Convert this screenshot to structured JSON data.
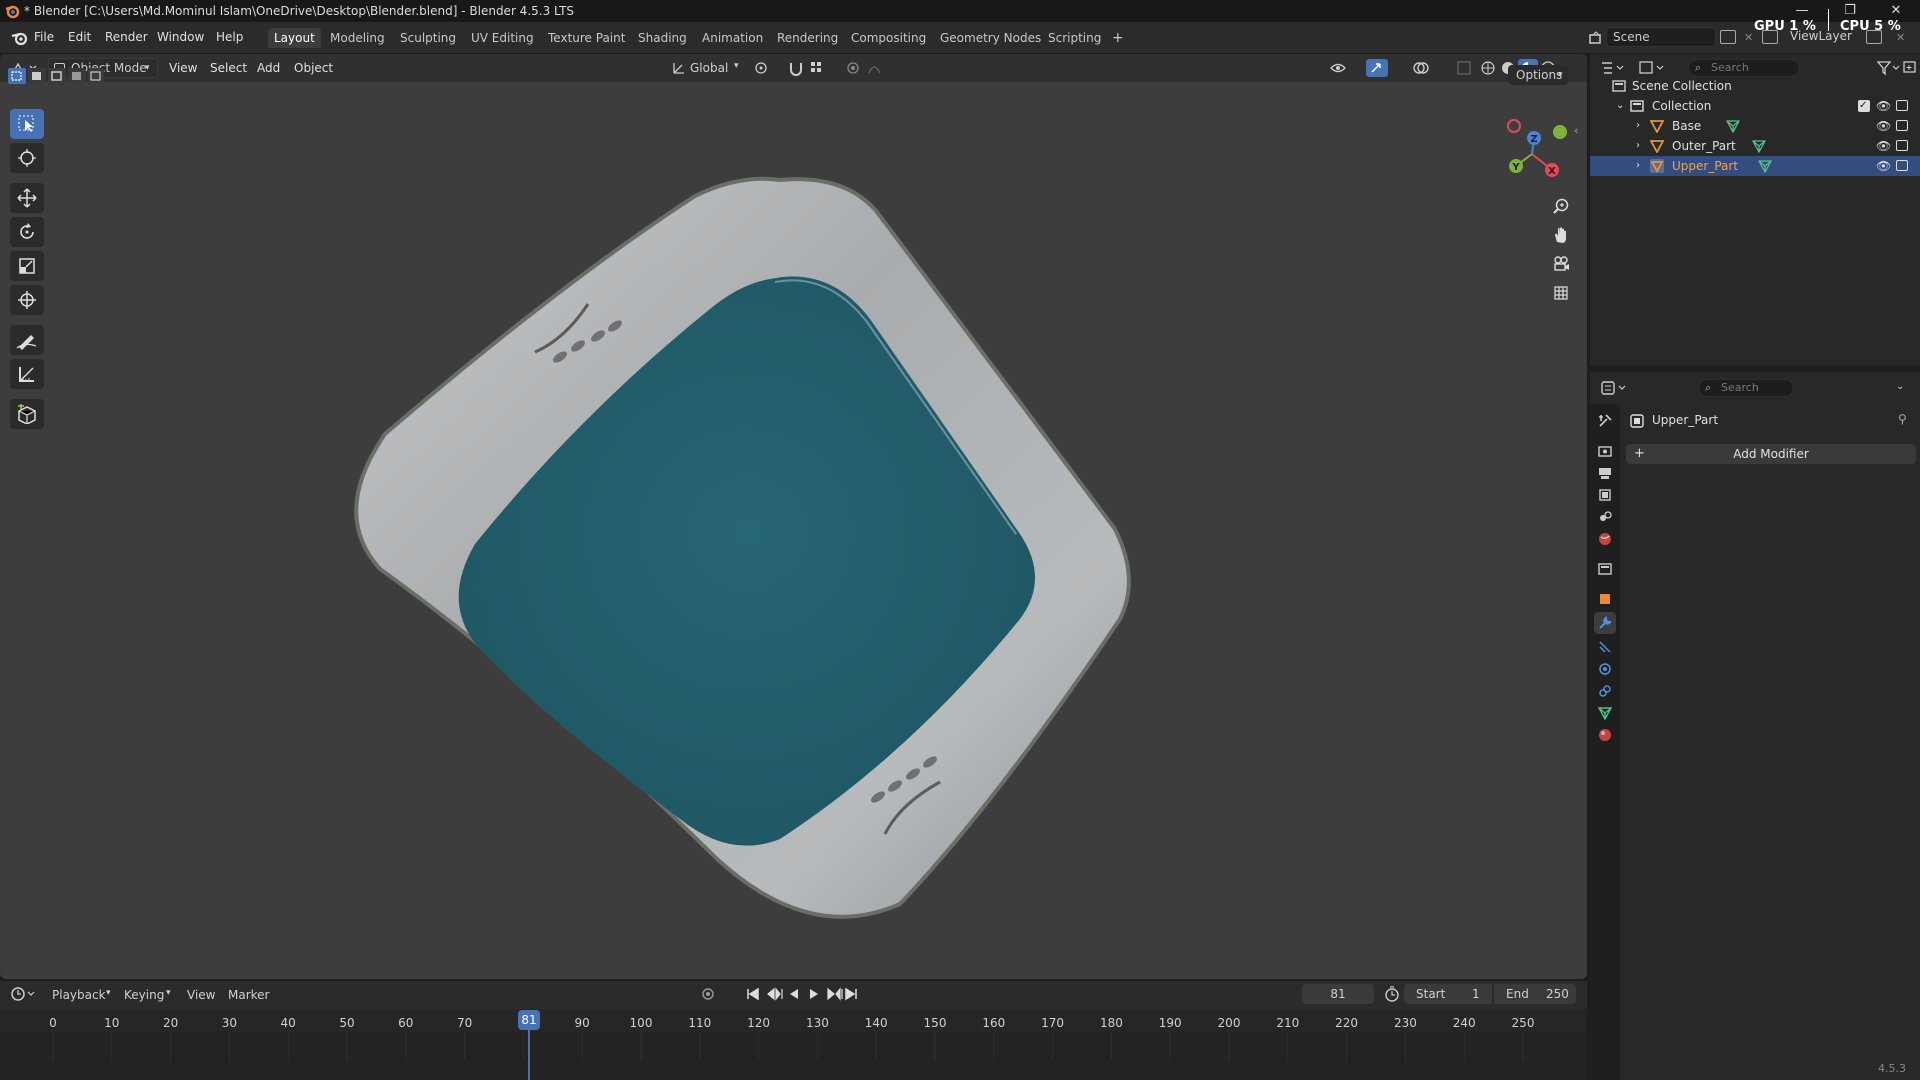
{
  "window": {
    "title": "* Blender [C:\\Users\\Md.Mominul Islam\\OneDrive\\Desktop\\Blender.blend] - Blender 4.5.3 LTS",
    "controls": [
      "—",
      "❐",
      "✕"
    ]
  },
  "menu": {
    "items": [
      "File",
      "Edit",
      "Render",
      "Window",
      "Help"
    ]
  },
  "workspaces": [
    "Layout",
    "Modeling",
    "Sculpting",
    "UV Editing",
    "Texture Paint",
    "Shading",
    "Animation",
    "Rendering",
    "Compositing",
    "Geometry Nodes",
    "Scripting"
  ],
  "workspace_active": "Layout",
  "add_workspace": "+",
  "scene_field": "Scene",
  "viewlayer_field": "ViewLayer",
  "stats": {
    "gpu_label": "GPU",
    "gpu_value": "1 %",
    "cpu_label": "CPU",
    "cpu_value": "5 %"
  },
  "viewport_header": {
    "mode": "Object Mode",
    "menus": [
      "View",
      "Select",
      "Add",
      "Object"
    ],
    "orientation": "Global",
    "options": "Options"
  },
  "toolbar_tools": [
    "select-box",
    "cursor",
    "move",
    "rotate",
    "scale",
    "transform",
    "annotate",
    "measure",
    "add-cube"
  ],
  "model": {
    "rim_color": "#a8abae",
    "inner_color": "#245f6a"
  },
  "gizmo": {
    "x": "X",
    "y": "Y",
    "z": "Z",
    "x_color": "#e04a5a",
    "y_color": "#7fb23a",
    "z_color": "#4a83d6"
  },
  "timeline": {
    "menus": [
      "Playback",
      "Keying",
      "View",
      "Marker"
    ],
    "current_frame": "81",
    "start_label": "Start",
    "start": "1",
    "end_label": "End",
    "end": "250",
    "ticks": [
      "0",
      "10",
      "20",
      "30",
      "40",
      "50",
      "60",
      "70",
      "90",
      "100",
      "110",
      "120",
      "130",
      "140",
      "150",
      "160",
      "170",
      "180",
      "190",
      "200",
      "210",
      "220",
      "230",
      "240",
      "250"
    ],
    "playhead": "81"
  },
  "outliner": {
    "search_placeholder": "Search",
    "scene_collection": "Scene Collection",
    "collection": "Collection",
    "objects": [
      {
        "name": "Base",
        "selected": false
      },
      {
        "name": "Outer_Part",
        "selected": false
      },
      {
        "name": "Upper_Part",
        "selected": true
      }
    ]
  },
  "properties": {
    "search_placeholder": "Search",
    "object_name": "Upper_Part",
    "add_modifier": "Add Modifier",
    "add_icon": "+"
  },
  "version": "4.5.3",
  "colors": {
    "accent": "#4772b3",
    "selected_row": "#334d80"
  }
}
